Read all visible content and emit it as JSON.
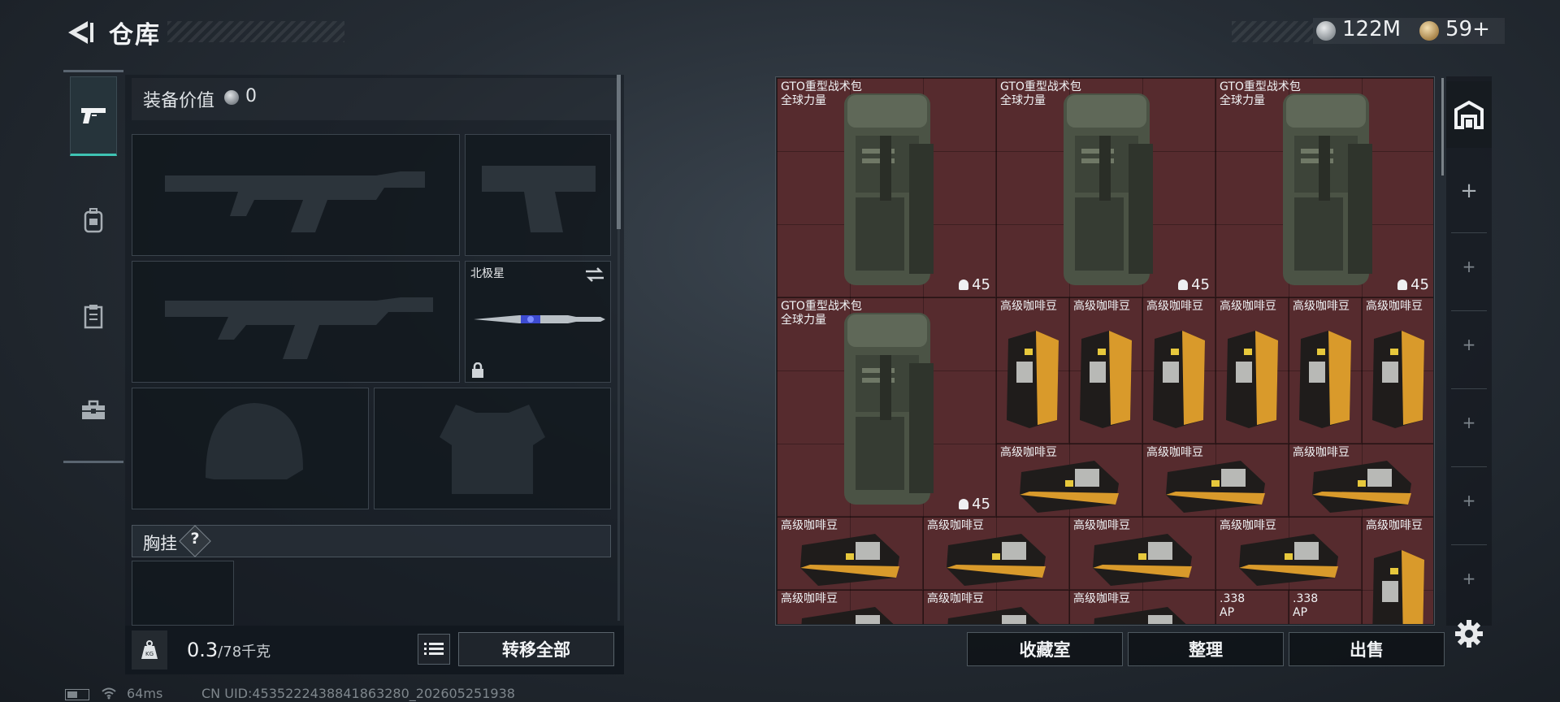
{
  "header": {
    "title": "仓库",
    "currency_silver": "122M",
    "currency_gold": "59+"
  },
  "side_tabs": [
    {
      "name": "weapons",
      "icon": "pistol-icon",
      "active": true
    },
    {
      "name": "backpack",
      "icon": "backpack-icon",
      "active": false
    },
    {
      "name": "vest",
      "icon": "clipboard-icon",
      "active": false
    },
    {
      "name": "case",
      "icon": "toolbox-icon",
      "active": false
    }
  ],
  "loadout": {
    "value_label": "装备价值",
    "value": "0",
    "knife_label": "北极星",
    "vest_label": "胸挂",
    "help": "?",
    "weight_current": "0.3",
    "weight_max": "/78千克",
    "transfer_all": "转移全部"
  },
  "stash": {
    "items": [
      {
        "name": "GTO重型战术包",
        "sub": "全球力量",
        "count": "45",
        "kind": "backpack"
      },
      {
        "name": "GTO重型战术包",
        "sub": "全球力量",
        "count": "45",
        "kind": "backpack"
      },
      {
        "name": "GTO重型战术包",
        "sub": "全球力量",
        "count": "45",
        "kind": "backpack"
      },
      {
        "name": "GTO重型战术包",
        "sub": "全球力量",
        "count": "45",
        "kind": "backpack"
      },
      {
        "name": "高级咖啡豆",
        "kind": "coffee"
      },
      {
        "name": "高级咖啡豆",
        "kind": "coffee"
      },
      {
        "name": "高级咖啡豆",
        "kind": "coffee"
      },
      {
        "name": "高级咖啡豆",
        "kind": "coffee"
      },
      {
        "name": "高级咖啡豆",
        "kind": "coffee"
      },
      {
        "name": "高级咖啡豆",
        "kind": "coffee"
      },
      {
        "name": "高级咖啡豆",
        "kind": "coffee-flat"
      },
      {
        "name": "高级咖啡豆",
        "kind": "coffee-flat"
      },
      {
        "name": "高级咖啡豆",
        "kind": "coffee-flat"
      },
      {
        "name": "高级咖啡豆",
        "kind": "coffee-flat"
      },
      {
        "name": "高级咖啡豆",
        "kind": "coffee-flat"
      },
      {
        "name": "高级咖啡豆",
        "kind": "coffee-flat"
      },
      {
        "name": "高级咖啡豆",
        "kind": "coffee-flat"
      },
      {
        "name": "高级咖啡豆",
        "kind": "coffee"
      },
      {
        "name": "高级咖啡豆",
        "kind": "coffee-flat"
      },
      {
        "name": "高级咖啡豆",
        "kind": "coffee-flat"
      },
      {
        "name": "高级咖啡豆",
        "kind": "coffee-flat"
      },
      {
        "name": ".338",
        "sub": "AP",
        "kind": "ammo"
      },
      {
        "name": ".338",
        "sub": "AP",
        "kind": "ammo"
      }
    ]
  },
  "actions": {
    "collection": "收藏室",
    "sort": "整理",
    "sell": "出售"
  },
  "status": {
    "ping": "64ms",
    "uid": "CN UID:4535222438841863280_202605251938"
  },
  "colors": {
    "accent": "#3ec3b3",
    "stash_bg": "#562b2e"
  }
}
